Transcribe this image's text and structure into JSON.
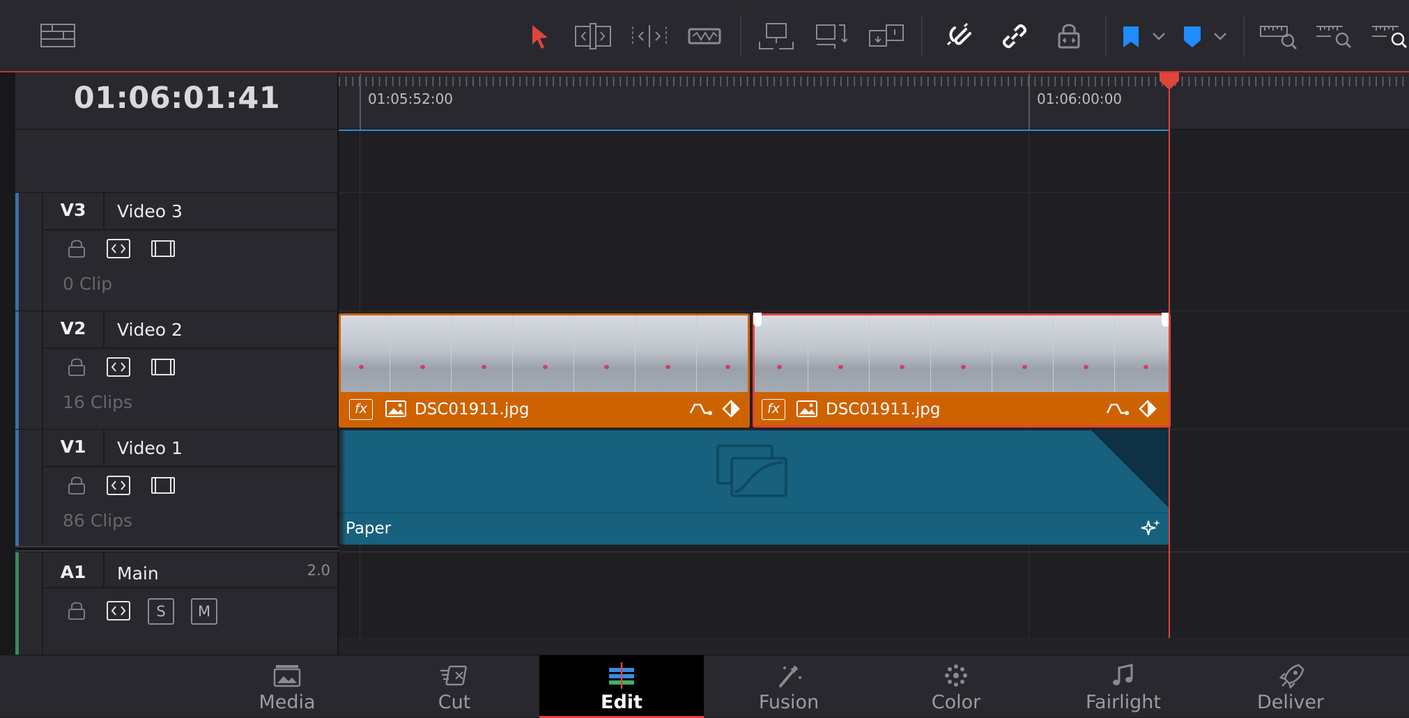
{
  "timecode": "01:06:01:41",
  "ruler": {
    "label_1": "01:05:52:00",
    "label_2": "01:06:00:00"
  },
  "toolbar": {
    "icons": [
      "timeline-view-options-icon",
      "selection-mode-icon",
      "trim-edit-mode-icon",
      "dynamic-trim-mode-icon",
      "blade-edit-mode-icon",
      "insert-clip-icon",
      "overwrite-clip-icon",
      "replace-clip-icon",
      "snapping-icon",
      "linked-selection-icon",
      "position-lock-icon",
      "flag-icon",
      "marker-icon",
      "zoom-full-icon",
      "zoom-detail-icon",
      "zoom-custom-icon"
    ],
    "accent_color": "#e0443a",
    "flag_color": "#1f8cff"
  },
  "tracks": [
    {
      "id": "V3",
      "name": "Video 3",
      "count": "0 Clip",
      "color": "#3e6ea8"
    },
    {
      "id": "V2",
      "name": "Video 2",
      "count": "16 Clips",
      "color": "#3e6ea8"
    },
    {
      "id": "V1",
      "name": "Video 1",
      "count": "86 Clips",
      "color": "#3e6ea8"
    },
    {
      "id": "A1",
      "name": "Main",
      "channels": "2.0",
      "solo": "S",
      "mute": "M",
      "color": "#3a8a5a"
    }
  ],
  "clips": {
    "v2_clip_1": {
      "name": "DSC01911.jpg",
      "color": "#cf6200"
    },
    "v2_clip_2": {
      "name": "DSC01911.jpg",
      "color": "#cf6200"
    },
    "v1_clip": {
      "name": "Paper",
      "color": "#17617e"
    }
  },
  "nav": [
    {
      "label": "Media",
      "active": false
    },
    {
      "label": "Cut",
      "active": false
    },
    {
      "label": "Edit",
      "active": true
    },
    {
      "label": "Fusion",
      "active": false
    },
    {
      "label": "Color",
      "active": false
    },
    {
      "label": "Fairlight",
      "active": false
    },
    {
      "label": "Deliver",
      "active": false
    }
  ]
}
